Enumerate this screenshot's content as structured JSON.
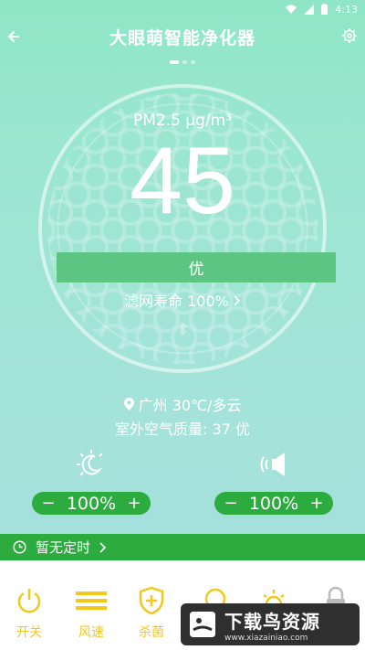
{
  "status_bar": {
    "time": "4:13"
  },
  "header": {
    "title": "大眼萌智能净化器"
  },
  "gauge": {
    "pm_label": "PM2.5  μg/m³",
    "pm_value": "45",
    "quality": "优",
    "filter_text": "滤网寿命 100%"
  },
  "weather": {
    "location": "广州 30℃/多云",
    "outdoor_quality": "室外空气质量: 37 优"
  },
  "controls": {
    "night_light": {
      "minus": "−",
      "value": "100%",
      "plus": "+"
    },
    "volume": {
      "minus": "−",
      "value": "100%",
      "plus": "+"
    }
  },
  "timer": {
    "text": "暂无定时"
  },
  "tabs": [
    {
      "label": "开关",
      "icon": "power-icon"
    },
    {
      "label": "风速",
      "icon": "fan-speed-icon"
    },
    {
      "label": "杀菌",
      "icon": "sterilize-shield-icon"
    },
    {
      "label": "",
      "icon": "child-lock-icon"
    },
    {
      "label": "",
      "icon": "light-icon"
    },
    {
      "label": "",
      "icon": "lock-icon"
    }
  ],
  "watermark": {
    "title": "下载鸟资源",
    "url": "www.xiazainiao.com"
  },
  "colors": {
    "accent_green": "#2cab3f",
    "quality_green": "#5cc582",
    "tab_yellow": "#f3c81b"
  }
}
